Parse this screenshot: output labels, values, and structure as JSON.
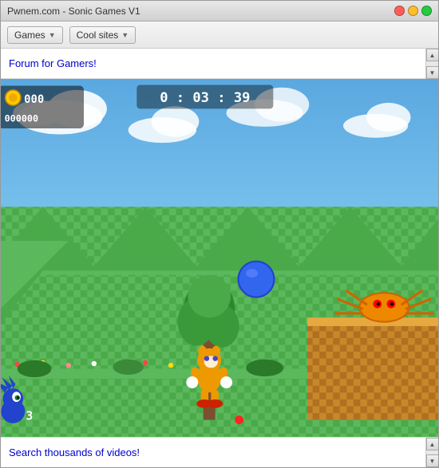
{
  "window": {
    "title": "Pwnem.com - Sonic Games V1"
  },
  "toolbar": {
    "games_label": "Games",
    "cool_sites_label": "Cool sites"
  },
  "top_link": {
    "text": "Forum for Gamers!"
  },
  "bottom_link": {
    "text": "Search thousands of videos!"
  },
  "game": {
    "rings": "000",
    "score": "000000",
    "timer": "0 : 03 : 39"
  },
  "icons": {
    "scroll_up": "▲",
    "scroll_down": "▼",
    "dropdown": "▼"
  }
}
